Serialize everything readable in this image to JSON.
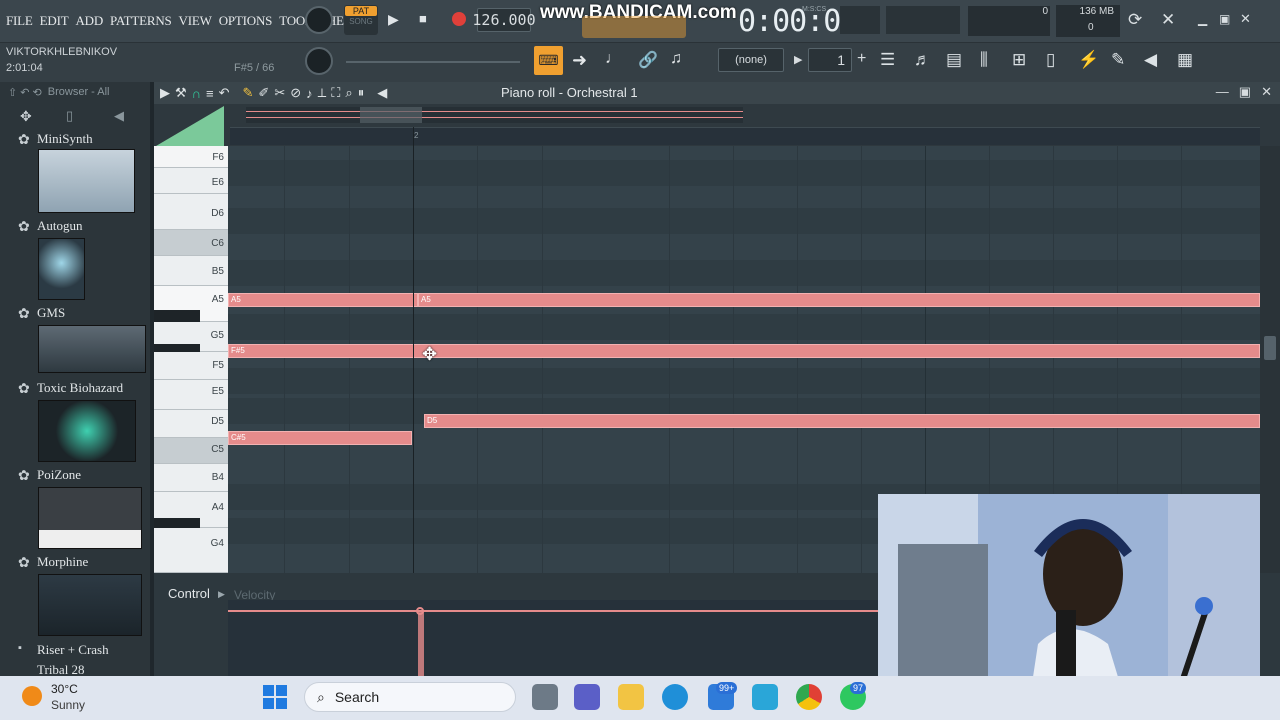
{
  "menu": [
    "FILE",
    "EDIT",
    "ADD",
    "PATTERNS",
    "VIEW",
    "OPTIONS",
    "TOOLS",
    "HELP"
  ],
  "transport": {
    "mode_pat": "PAT",
    "mode_song": "SONG",
    "tempo": "126.000",
    "time": "0:00:00",
    "time_unit": "M:S:CS",
    "cpu": "0",
    "memory": "136 MB",
    "poly": "0"
  },
  "project": {
    "user": "VIKTORKHLEBNIKOV",
    "time": "2:01:04",
    "hint": "F#5 / 66"
  },
  "toolbar2": {
    "pattern_select": "(none)",
    "pattern_number": "1"
  },
  "watermark": "www.BANDICAM.com",
  "browser": {
    "title": "Browser - All"
  },
  "plugins": [
    {
      "name": "MiniSynth"
    },
    {
      "name": "Autogun"
    },
    {
      "name": "GMS"
    },
    {
      "name": "Toxic Biohazard"
    },
    {
      "name": "PoiZone"
    },
    {
      "name": "Morphine"
    },
    {
      "name": "Riser + Crash"
    },
    {
      "name": "Tribal 28"
    }
  ],
  "piano_roll": {
    "title": "Piano roll - Orchestral 1",
    "ruler_bar": "2",
    "keys": [
      "F6",
      "E6",
      "D6",
      "C6",
      "B5",
      "A5",
      "G5",
      "F5",
      "E5",
      "D5",
      "C5",
      "B4",
      "A4",
      "G4"
    ],
    "notes": [
      {
        "label": "A5"
      },
      {
        "label": "A5"
      },
      {
        "label": "F#5"
      },
      {
        "label": "D5"
      },
      {
        "label": "C#5"
      }
    ]
  },
  "control": {
    "label": "Control",
    "target": "Velocity"
  },
  "taskbar": {
    "temperature": "30°C",
    "condition": "Sunny",
    "search_placeholder": "Search",
    "badge_mail": "99+",
    "badge_whatsapp": "97"
  },
  "colors": {
    "note": "#e58b8b",
    "grid": "#34424a",
    "accent": "#f0a030"
  }
}
